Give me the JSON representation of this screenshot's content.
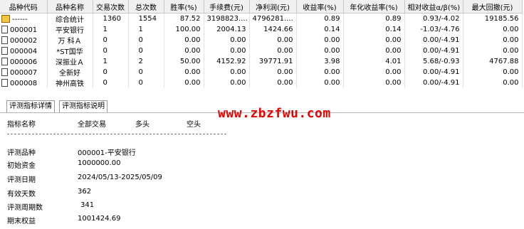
{
  "grid": {
    "columns": [
      "品种代码",
      "品种名称",
      "交易次数",
      "总次数",
      "胜率(%)",
      "手续费(元)",
      "净利润(元)",
      "收益率(%)",
      "年化收益率(%)",
      "相对收益α/β(%)",
      "最大回撤(元)"
    ],
    "rows": [
      {
        "code": "------",
        "icon": "summary",
        "name": "综合统计",
        "trades": "1360",
        "total": "1554",
        "winrate": "87.52",
        "fee": "3198823....",
        "profit": "4796281....",
        "ret": "0.89",
        "annual": "0.89",
        "alpha": "0.93/-4.02",
        "maxdd": "19185.56"
      },
      {
        "code": "000001",
        "icon": "doc",
        "name": "平安银行",
        "trades": "1",
        "total": "1",
        "winrate": "100.00",
        "fee": "2004.13",
        "profit": "1424.66",
        "ret": "0.14",
        "annual": "0.14",
        "alpha": "-1.03/-4.76",
        "maxdd": "0.00"
      },
      {
        "code": "000002",
        "icon": "doc",
        "name": "万 科Ａ",
        "trades": "0",
        "total": "0",
        "winrate": "0.00",
        "fee": "0.00",
        "profit": "0.00",
        "ret": "0.00",
        "annual": "0.00",
        "alpha": "0.00/-4.91",
        "maxdd": "0.00"
      },
      {
        "code": "000004",
        "icon": "doc",
        "name": "*ST国华",
        "trades": "0",
        "total": "0",
        "winrate": "0.00",
        "fee": "0.00",
        "profit": "0.00",
        "ret": "0.00",
        "annual": "0.00",
        "alpha": "0.00/-4.91",
        "maxdd": "0.00"
      },
      {
        "code": "000006",
        "icon": "doc",
        "name": "深振业Ａ",
        "trades": "1",
        "total": "2",
        "winrate": "50.00",
        "fee": "4152.92",
        "profit": "39771.91",
        "ret": "3.98",
        "annual": "4.01",
        "alpha": "5.68/-0.93",
        "maxdd": "4767.88"
      },
      {
        "code": "000007",
        "icon": "doc",
        "name": "全新好",
        "trades": "0",
        "total": "0",
        "winrate": "0.00",
        "fee": "0.00",
        "profit": "0.00",
        "ret": "0.00",
        "annual": "0.00",
        "alpha": "0.00/-4.91",
        "maxdd": "0.00"
      },
      {
        "code": "000008",
        "icon": "doc",
        "name": "神州高铁",
        "trades": "0",
        "total": "0",
        "winrate": "0.00",
        "fee": "0.00",
        "profit": "0.00",
        "ret": "0.00",
        "annual": "0.00",
        "alpha": "0.00/-4.91",
        "maxdd": "0.00"
      }
    ]
  },
  "tabs": [
    "评测指标详情",
    "评测指标说明"
  ],
  "watermark": "www.zbzfwu.com",
  "detail": {
    "header": {
      "name": "指标名称",
      "all": "全部交易",
      "long": "多头",
      "short": "空头"
    },
    "rows": [
      {
        "label": "评测品种",
        "value": "000001-平安银行"
      },
      {
        "label": "初始资金",
        "value": "1000000.00"
      },
      {
        "label": "评测日期",
        "value": "2024/05/13-2025/05/09"
      },
      {
        "label": "有效天数",
        "value": "362"
      },
      {
        "label": "评测周期数",
        "value": "341"
      },
      {
        "label": "期末权益",
        "value": "1001424.69"
      }
    ]
  }
}
